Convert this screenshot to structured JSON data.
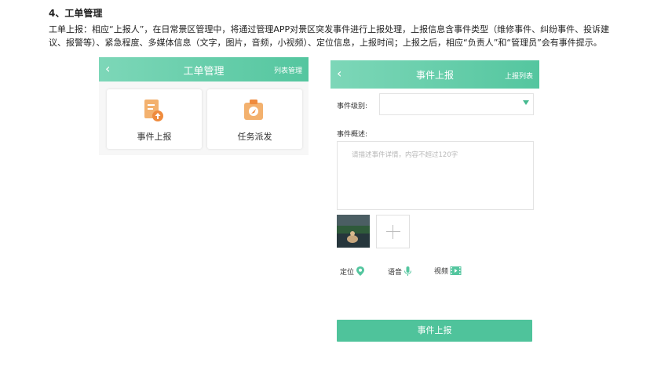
{
  "doc": {
    "heading": "4、工单管理",
    "paragraph": "工单上报：相应“上报人”，在日常景区管理中，将通过管理APP对景区突发事件进行上报处理，上报信息含事件类型（维修事件、纠纷事件、投诉建议、报警等）、紧急程度、多媒体信息（文字，图片，音频，小视频）、定位信息，上报时间；上报之后，相应“负责人”和“管理员”会有事件提示。"
  },
  "screen_a": {
    "back": "‹",
    "title": "工单管理",
    "right_link": "列表管理",
    "tiles": [
      {
        "label": "事件上报",
        "icon": "report-upload-icon"
      },
      {
        "label": "任务派发",
        "icon": "task-dispatch-icon"
      }
    ]
  },
  "screen_b": {
    "back": "‹",
    "title": "事件上报",
    "right_link": "上报列表",
    "level_label": "事件级别:",
    "level_value": "",
    "desc_label": "事件概述:",
    "desc_placeholder": "请描述事件详情，内容不超过120字",
    "tools": [
      {
        "label": "定位",
        "icon": "location-pin-icon"
      },
      {
        "label": "语音",
        "icon": "microphone-icon"
      },
      {
        "label": "视频",
        "icon": "video-icon"
      }
    ],
    "submit": "事件上报"
  },
  "colors": {
    "accent": "#54c69f",
    "accent_light": "#7dd7b8",
    "icon_orange": "#f0a25a"
  }
}
